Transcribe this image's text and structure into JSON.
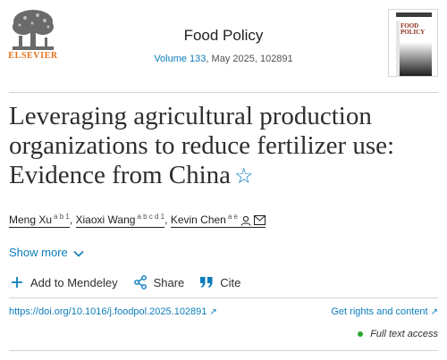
{
  "publisher": {
    "name": "ELSEVIER",
    "logo_icon": "elsevier-tree-logo",
    "brand_color": "#e9711c"
  },
  "journal": {
    "title": "Food Policy",
    "volume": "Volume 133",
    "issue_info": ", May 2025, 102891",
    "cover_title": "FOOD POLICY"
  },
  "article": {
    "title": "Leveraging agricultural production organizations to reduce fertilizer use: Evidence from China",
    "title_icon": "star-icon"
  },
  "authors": [
    {
      "name": "Meng Xu",
      "affiliations": "a b 1"
    },
    {
      "name": "Xiaoxi Wang",
      "affiliations": "a b c d 1"
    },
    {
      "name": "Kevin Chen",
      "affiliations": "a e"
    }
  ],
  "author_separator": ",",
  "show_more": {
    "label": "Show more",
    "icon": "chevron-down-icon"
  },
  "actions": [
    {
      "label": "Add to Mendeley",
      "icon": "plus-icon"
    },
    {
      "label": "Share",
      "icon": "share-icon"
    },
    {
      "label": "Cite",
      "icon": "quote-icon"
    }
  ],
  "links": {
    "doi": "https://doi.org/10.1016/j.foodpol.2025.102891",
    "rights": "Get rights and content",
    "external_icon": "↗"
  },
  "access": {
    "label": "Full text access",
    "status_color": "#29a82f"
  },
  "colors": {
    "link": "#0c7dbb",
    "text": "#2e2e2e"
  }
}
